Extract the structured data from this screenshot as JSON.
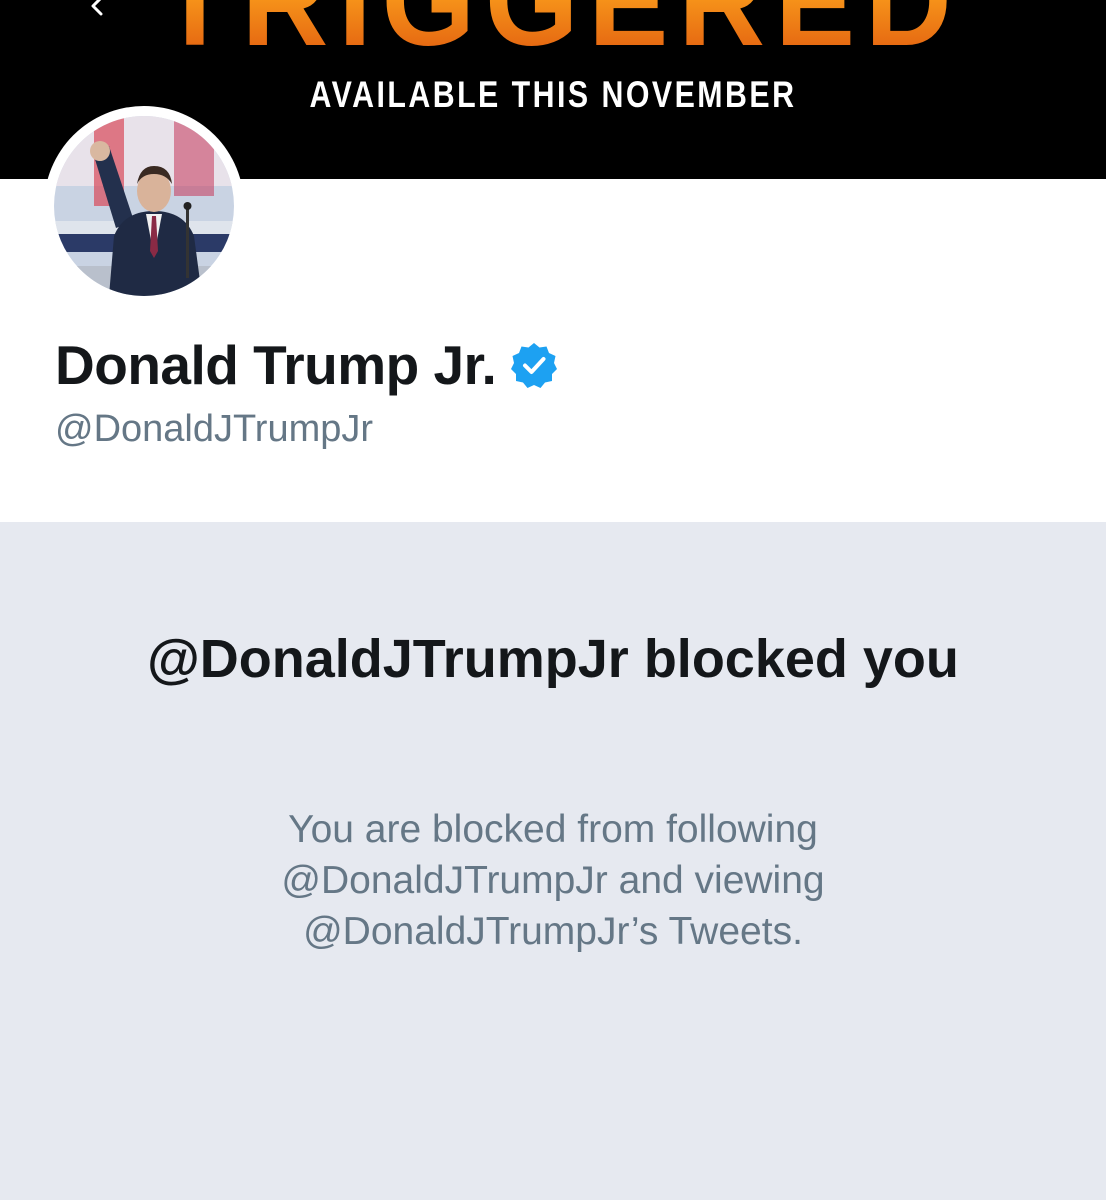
{
  "banner": {
    "title_partial": "TRIGGERED",
    "subtitle": "AVAILABLE THIS NOVEMBER"
  },
  "profile": {
    "display_name": "Donald Trump Jr.",
    "handle": "@DonaldJTrumpJr",
    "verified": true
  },
  "blocked": {
    "title": "@DonaldJTrumpJr blocked you",
    "description": "You are blocked from following @DonaldJTrumpJr and viewing @DonaldJTrumpJr’s Tweets."
  },
  "icons": {
    "back": "back-arrow-icon",
    "verified": "verified-badge-icon"
  },
  "colors": {
    "banner_bg": "#000000",
    "banner_text": "#ffffff",
    "banner_accent": "#f39a1c",
    "name_text": "#14171a",
    "secondary_text": "#657786",
    "verified_blue": "#1da1f2",
    "blocked_bg": "#e6e9f0"
  }
}
